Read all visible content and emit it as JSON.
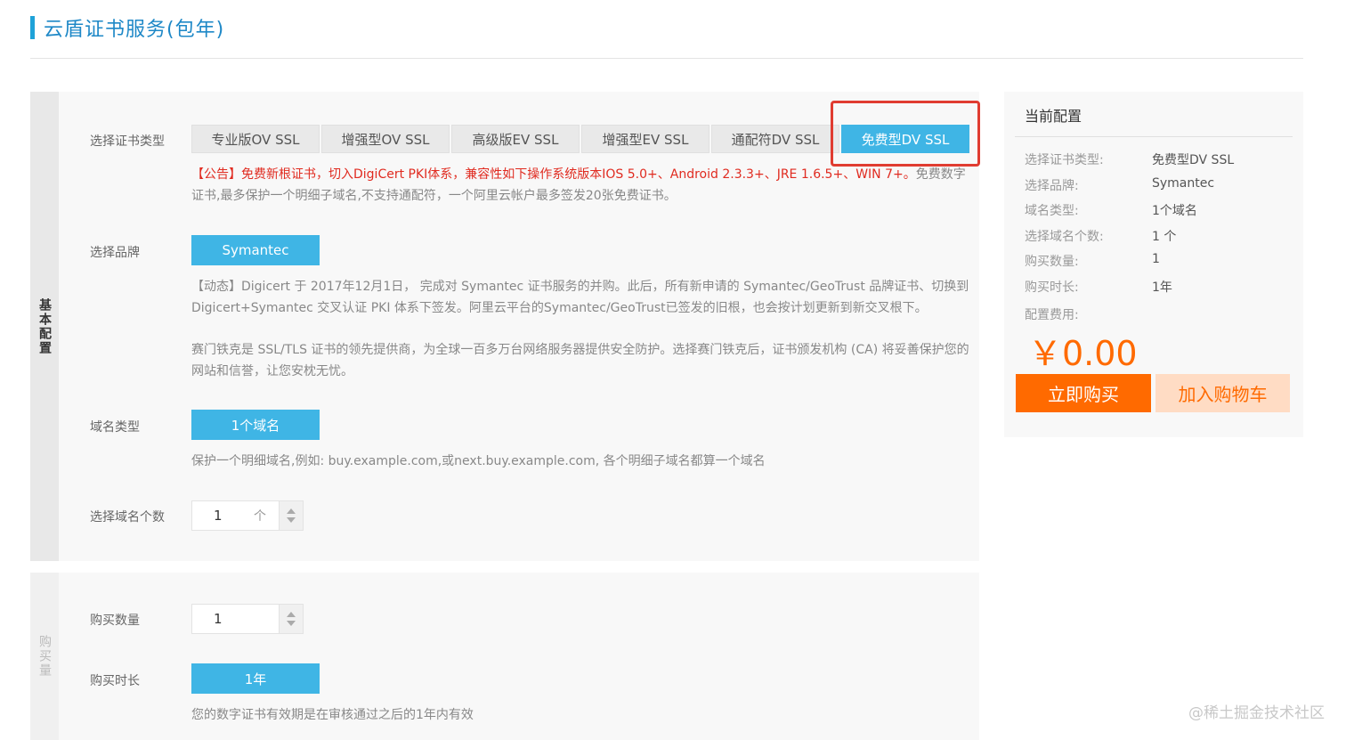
{
  "page": {
    "title": "云盾证书服务(包年)"
  },
  "basic": {
    "side_label": "基本配置",
    "cert_type": {
      "label": "选择证书类型",
      "options": [
        "专业版OV SSL",
        "增强型OV SSL",
        "高级版EV SSL",
        "增强型EV SSL",
        "通配符DV SSL",
        "免费型DV SSL"
      ],
      "selected_index": 5
    },
    "notice": {
      "red": "【公告】免费新根证书，切入DigiCert PKI体系，兼容性如下操作系统版本IOS 5.0+、Android 2.3.3+、JRE 1.6.5+、WIN 7+。",
      "gray": "免费数字证书,最多保护一个明细子域名,不支持通配符，一个阿里云帐户最多签发20张免费证书。"
    },
    "brand": {
      "label": "选择品牌",
      "value": "Symantec",
      "desc1": "【动态】Digicert 于 2017年12月1日， 完成对 Symantec 证书服务的并购。此后，所有新申请的 Symantec/GeoTrust 品牌证书、切换到 Digicert+Symantec 交叉认证 PKI 体系下签发。阿里云平台的Symantec/GeoTrust已签发的旧根，也会按计划更新到新交叉根下。",
      "desc2": "赛门铁克是 SSL/TLS 证书的领先提供商，为全球一百多万台网络服务器提供安全防护。选择赛门铁克后，证书颁发机构 (CA) 将妥善保护您的网站和信誉，让您安枕无忧。"
    },
    "domain_type": {
      "label": "域名类型",
      "value": "1个域名",
      "desc": "保护一个明细域名,例如: buy.example.com,或next.buy.example.com, 各个明细子域名都算一个域名"
    },
    "domain_count": {
      "label": "选择域名个数",
      "value": "1",
      "unit": "个"
    }
  },
  "purchase": {
    "side_label": "购买量",
    "quantity": {
      "label": "购买数量",
      "value": "1"
    },
    "duration": {
      "label": "购买时长",
      "value": "1年",
      "desc": "您的数字证书有效期是在审核通过之后的1年内有效"
    }
  },
  "config": {
    "title": "当前配置",
    "rows": [
      {
        "k": "选择证书类型:",
        "v": "免费型DV SSL"
      },
      {
        "k": "选择品牌:",
        "v": "Symantec"
      },
      {
        "k": "域名类型:",
        "v": "1个域名"
      },
      {
        "k": "选择域名个数:",
        "v": "1 个"
      },
      {
        "k": "购买数量:",
        "v": "1"
      },
      {
        "k": "购买时长:",
        "v": "1年"
      }
    ],
    "fee_label": "配置费用:",
    "price": "￥0.00",
    "buy_now": "立即购买",
    "add_cart": "加入购物车"
  },
  "watermark": "@稀土掘金技术社区",
  "colors": {
    "accent": "#3fb5e5",
    "orange": "#ff6a00",
    "alert_red": "#e02b20",
    "highlight": "#e03c31"
  }
}
